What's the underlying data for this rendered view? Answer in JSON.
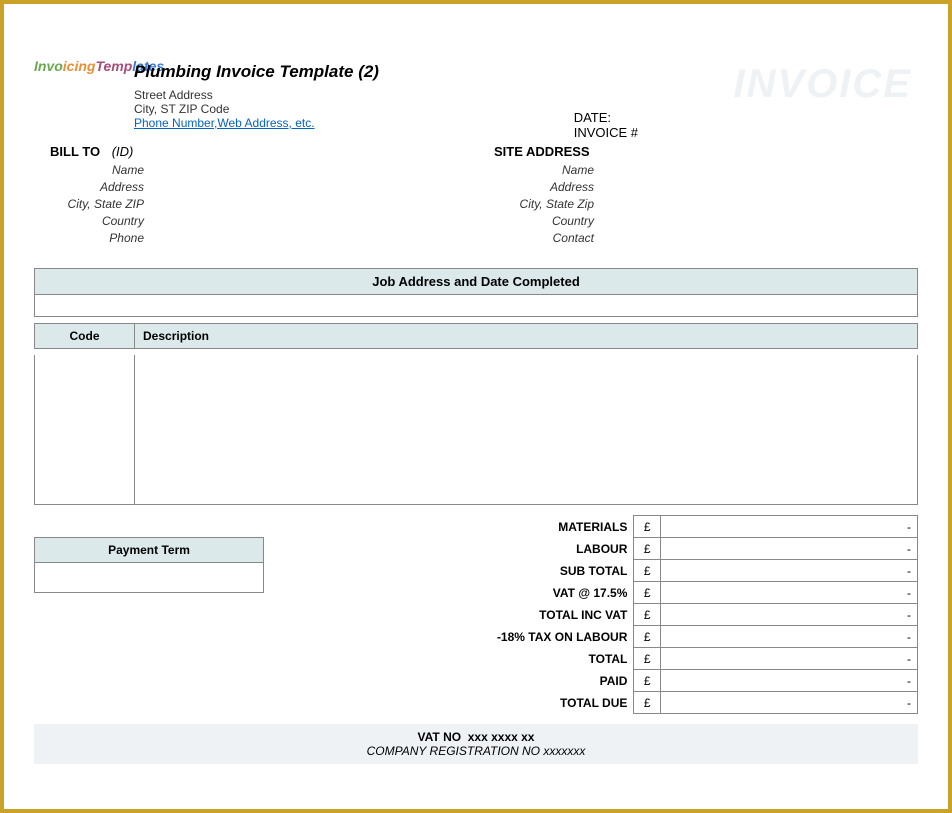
{
  "header": {
    "title": "Plumbing Invoice Template (2)",
    "street": "Street Address",
    "city": "City, ST  ZIP Code",
    "link": "Phone Number,Web Address, etc.",
    "watermark": "INVOICE",
    "logo": "InvoicingTemplates"
  },
  "meta": {
    "date_label": "DATE:",
    "invoice_label": "INVOICE #"
  },
  "billto": {
    "title": "BILL TO",
    "id": "(ID)",
    "name": "Name",
    "address": "Address",
    "csz": "City, State ZIP",
    "country": "Country",
    "phone": "Phone"
  },
  "site": {
    "title": "SITE ADDRESS",
    "name": "Name",
    "address": "Address",
    "csz": "City, State Zip",
    "country": "Country",
    "contact": "Contact"
  },
  "job_bar": "Job Address and Date Completed",
  "columns": {
    "code": "Code",
    "desc": "Description"
  },
  "payment_term_label": "Payment Term",
  "currency": "£",
  "totals": [
    {
      "label": "MATERIALS",
      "value": "-"
    },
    {
      "label": "LABOUR",
      "value": "-"
    },
    {
      "label": "SUB TOTAL",
      "value": "-"
    },
    {
      "label": "VAT @ 17.5%",
      "value": "-"
    },
    {
      "label": "TOTAL INC VAT",
      "value": "-"
    },
    {
      "label": "-18% TAX ON LABOUR",
      "value": "-"
    },
    {
      "label": "TOTAL",
      "value": "-"
    },
    {
      "label": "PAID",
      "value": "-"
    },
    {
      "label": "TOTAL DUE",
      "value": "-"
    }
  ],
  "footer": {
    "vat_label": "VAT NO",
    "vat_value": "xxx xxxx xx",
    "reg_label": "COMPANY REGISTRATION NO",
    "reg_value": "xxxxxxx"
  }
}
